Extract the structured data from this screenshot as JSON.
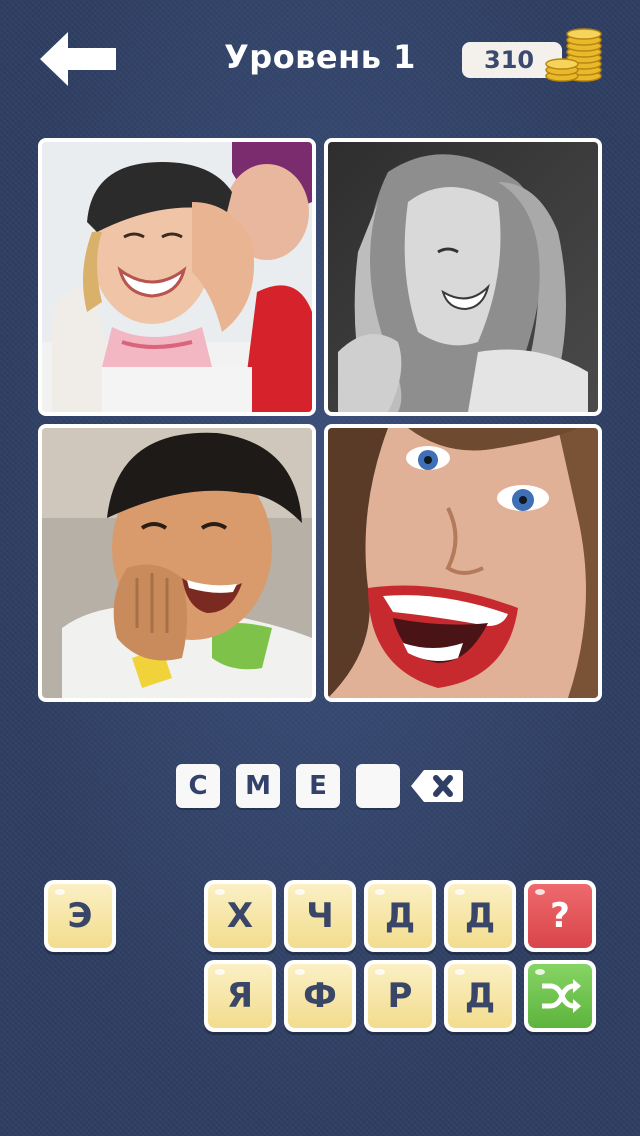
{
  "header": {
    "title": "Уровень 1",
    "coins": "310"
  },
  "photos": [
    {
      "name": "photo-couple-laughing"
    },
    {
      "name": "photo-woman-laughing-bw"
    },
    {
      "name": "photo-boy-laughing"
    },
    {
      "name": "photo-woman-open-mouth-laughing"
    }
  ],
  "answer": {
    "slots": [
      "С",
      "М",
      "Е",
      ""
    ]
  },
  "keyboard": {
    "row1": [
      "Э",
      "Х",
      "Ч",
      "Д",
      "Д"
    ],
    "row2": [
      "Я",
      "Ф",
      "Р",
      "Д"
    ],
    "hint_label": "?",
    "shuffle_icon": "shuffle-icon"
  },
  "colors": {
    "background": "#2f3f63",
    "tile": "#f7e6a6",
    "hint": "#e85256",
    "shuffle": "#6cc54b"
  }
}
